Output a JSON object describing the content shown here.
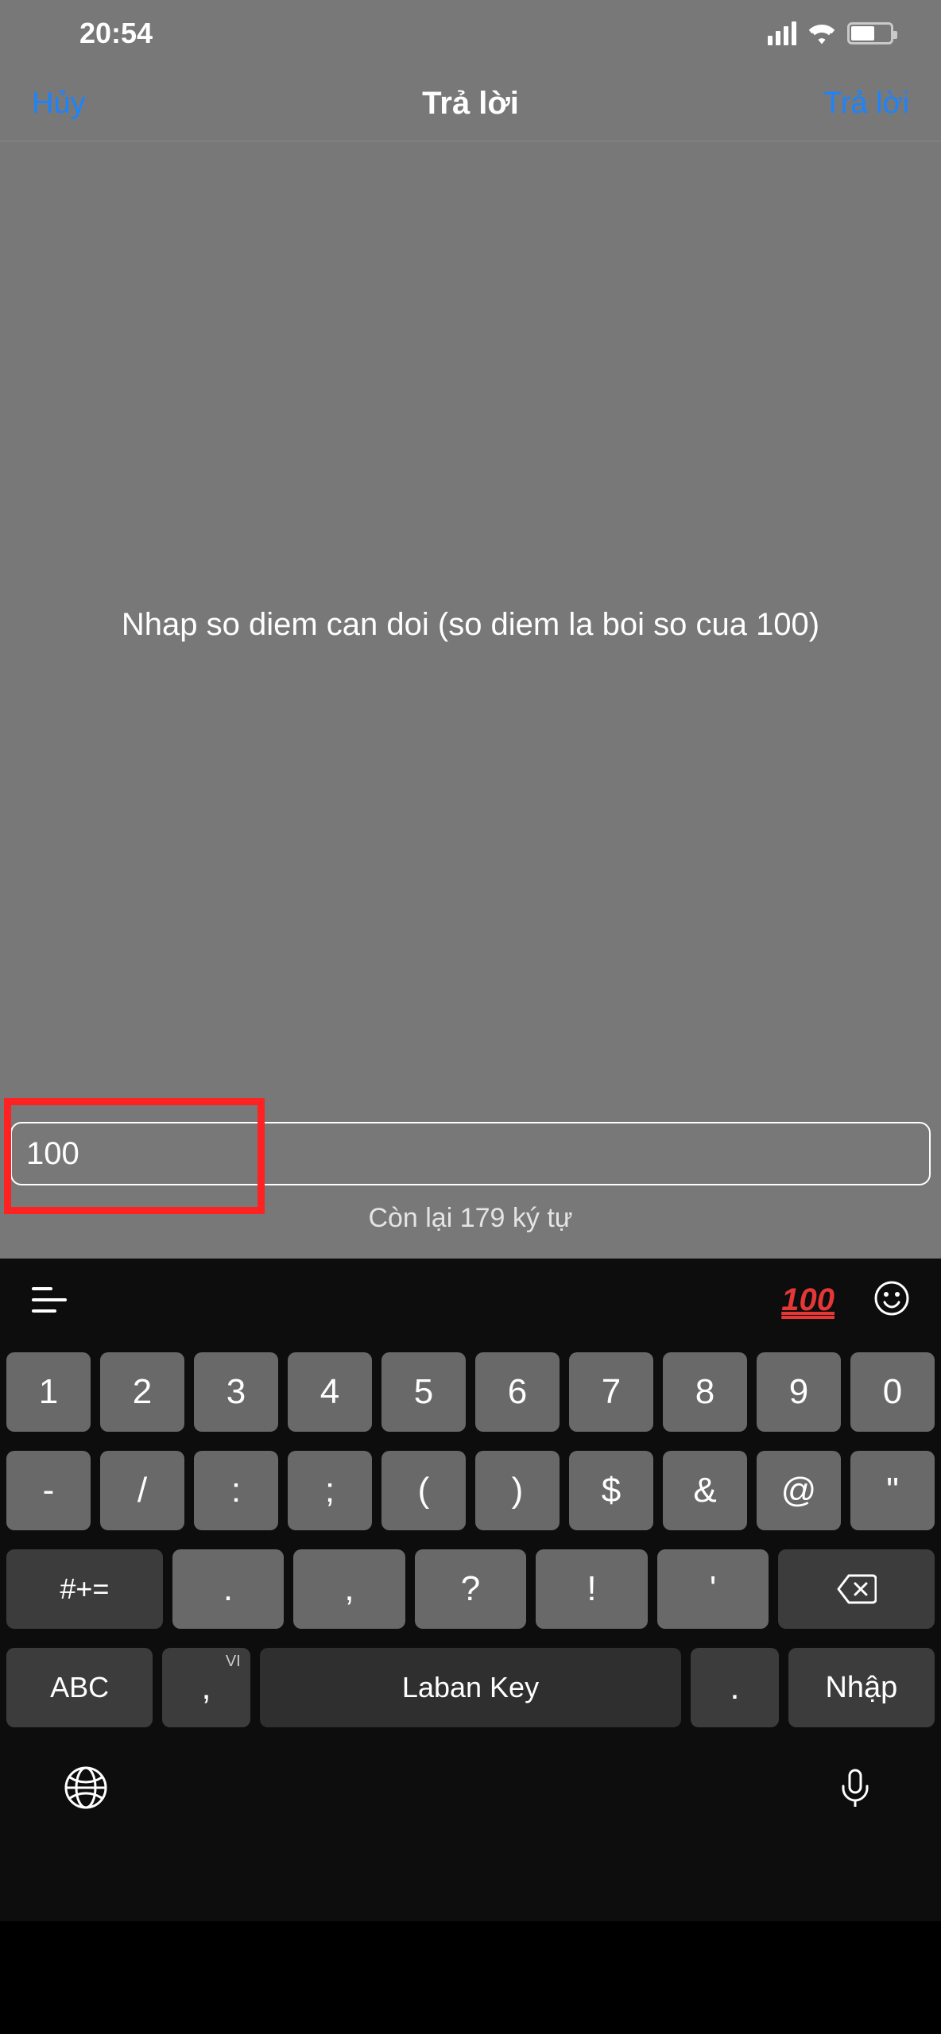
{
  "status": {
    "time": "20:54"
  },
  "nav": {
    "cancel": "Hủy",
    "title": "Trả lời",
    "submit": "Trả lời"
  },
  "content": {
    "prompt": "Nhap so diem can doi (so diem la boi so cua 100)",
    "input_value": "100",
    "char_count": "Còn lại 179 ký tự"
  },
  "toolbar": {
    "suggestion": "100"
  },
  "keyboard": {
    "row1": [
      "1",
      "2",
      "3",
      "4",
      "5",
      "6",
      "7",
      "8",
      "9",
      "0"
    ],
    "row2": [
      "-",
      "/",
      ":",
      ";",
      "(",
      ")",
      "$",
      "&",
      "@",
      "\""
    ],
    "row3_shift": "#+=",
    "row3": [
      ".",
      ",",
      "?",
      "!",
      "'"
    ],
    "row4": {
      "mode": "ABC",
      "comma": ",",
      "comma_sup": "VI",
      "space": "Laban Key",
      "dot": ".",
      "enter": "Nhập"
    }
  }
}
